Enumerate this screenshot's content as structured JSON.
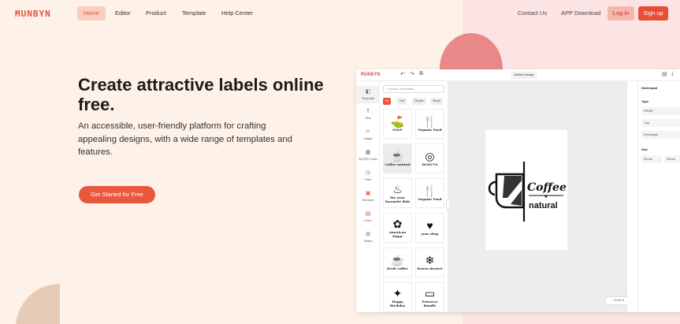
{
  "nav": {
    "logo": "MUNBYN",
    "links": [
      "Home",
      "Editor",
      "Product",
      "Template",
      "Help Center"
    ],
    "right_links": [
      "Contact Us",
      "APP Download"
    ],
    "login": "Log in",
    "signup": "Sign up"
  },
  "hero": {
    "title": "Create attractive labels online free.",
    "subtitle": "An accessible, user-friendly platform for crafting appealing designs, with a wide range of templates and features.",
    "cta": "Get Started for Free"
  },
  "editor": {
    "logo": "MUNBYN",
    "doc_name": "Untitled design",
    "sidebar": [
      "Template",
      "Text",
      "Image",
      "BC/QR Code",
      "Time",
      "Element",
      "Form",
      "Tables"
    ],
    "search_placeholder": "Search Templates",
    "chips": [
      "All",
      "Hot",
      "Simple",
      "Simpl"
    ],
    "templates": [
      {
        "caption": "GOLF"
      },
      {
        "caption": "Organic Food"
      },
      {
        "caption": "Coffee natural"
      },
      {
        "caption": "DONUTS"
      },
      {
        "caption": "the your favourite dish"
      },
      {
        "caption": "Organic Food"
      },
      {
        "caption": "American Sugar"
      },
      {
        "caption": "your shop"
      },
      {
        "caption": "fresh coffee"
      },
      {
        "caption": "frozen dessert"
      },
      {
        "caption": "Happy Birthday"
      },
      {
        "caption": "Prosecco Bundle"
      }
    ],
    "label_text_1": "Coffee",
    "label_text_2": "natural",
    "zoom": "100%",
    "props": {
      "section": "Sketchpad",
      "type_label": "Type",
      "type_options": [
        "PRMR",
        "Cap",
        "Rectangle"
      ],
      "size_label": "Size",
      "size_values": [
        "50mm",
        "50mm"
      ]
    }
  },
  "colors": {
    "accent": "#e9573f",
    "bg_peach": "#fdf1e8",
    "bg_pink": "#fde4e4"
  }
}
